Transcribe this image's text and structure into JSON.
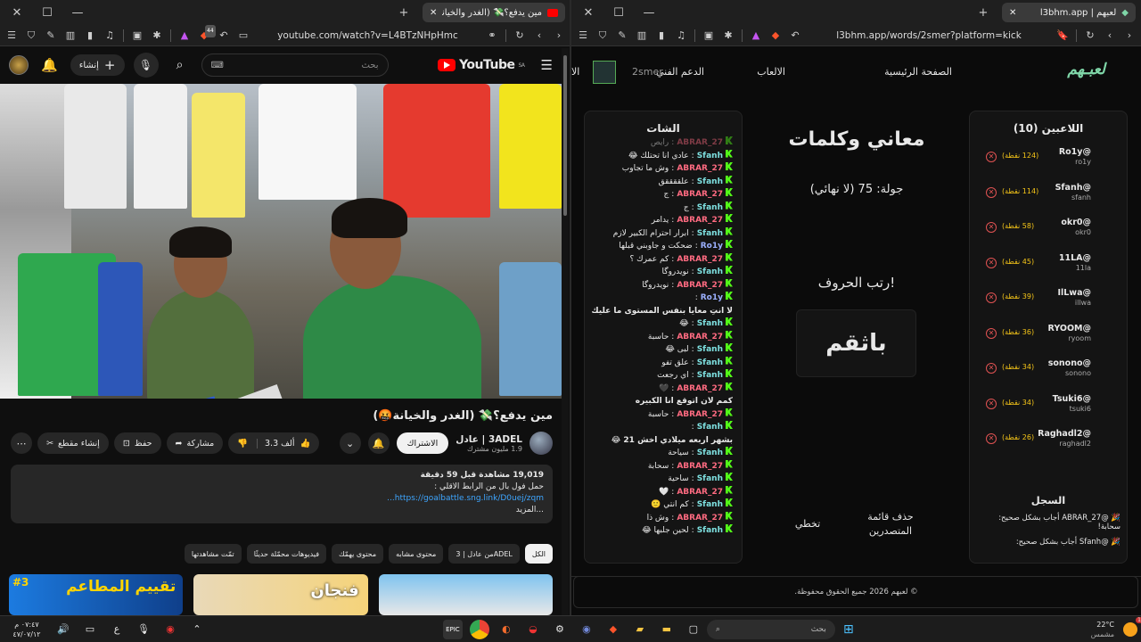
{
  "left_browser": {
    "tab_title": "مين يدفع؟💸 (الغدر والخيانة🤬)",
    "url": "youtube.com/watch?v=L4BTzNHpHmc",
    "extension_badge": "44"
  },
  "youtube": {
    "logo": "YouTube",
    "region": "SA",
    "search_placeholder": "بحث",
    "create_label": "إنشاء",
    "video_title": "مين يدفع؟💸 (الغدر والخيانة🤬)",
    "channel_name": "3ADEL | عادل",
    "channel_subs": "1.9 مليون مشترك",
    "subscribe_label": "الاشتراك",
    "likes": "3.3 ألف",
    "share_label": "مشاركة",
    "save_label": "حفظ",
    "clip_label": "إنشاء مقطع",
    "description": {
      "stats": "19,019 مشاهدة قبل 59 دقيقة",
      "line1": "حمل فول بال من الرابط الاقلي :",
      "link": "https://goalbattle.sng.link/D0uej/zqm...",
      "more": "...المزيد"
    },
    "chips": [
      "الكل",
      "من عادل | 3ADEL",
      "محتوى مشابه",
      "محتوى يهمّك",
      "فيديوهات محمّلة حديثًا",
      "تمّت مشاهدتها"
    ],
    "thumb_texts": [
      "تقييم المطاعم",
      "#3",
      "فنجان"
    ]
  },
  "right_browser": {
    "tab_title": "لعبهم | l3bhm.app",
    "url": "l3bhm.app/words/2smer?platform=kick"
  },
  "site": {
    "brand": "لعبـهم",
    "nav": [
      "الصفحة الرئيسية",
      "الالعاب",
      "الدعم الفني",
      "الا"
    ],
    "user": "2smer",
    "chat_title": "الشات",
    "chat": [
      {
        "u": "ABRAR_27",
        "m": "رايص",
        "faded": true
      },
      {
        "u": "Sfanh",
        "m": "عادي انا تحتلك 😂"
      },
      {
        "u": "ABRAR_27",
        "m": "وش ما تجاوب"
      },
      {
        "u": "Sfanh",
        "m": "علققققق"
      },
      {
        "u": "ABRAR_27",
        "m": "ج"
      },
      {
        "u": "Sfanh",
        "m": "ج"
      },
      {
        "u": "ABRAR_27",
        "m": "يدامر"
      },
      {
        "u": "Sfanh",
        "m": "ابرار احترام الكبير لازم"
      },
      {
        "u": "Ro1y",
        "m": "ضحكت و جاوبني قبلها"
      },
      {
        "u": "ABRAR_27",
        "m": "كم عمرك ؟"
      },
      {
        "u": "Sfanh",
        "m": "نويدروگا"
      },
      {
        "u": "ABRAR_27",
        "m": "نويدروگا"
      },
      {
        "u": "Ro1y",
        "m": ""
      },
      {
        "u": "",
        "m": "لا انتِ معايا بنفس المستوى ما عليك"
      },
      {
        "u": "Sfanh",
        "m": "😂"
      },
      {
        "u": "ABRAR_27",
        "m": "حاسبة"
      },
      {
        "u": "Sfanh",
        "m": "لبى 😂"
      },
      {
        "u": "Sfanh",
        "m": "علق تفو"
      },
      {
        "u": "Sfanh",
        "m": "اي رجعت"
      },
      {
        "u": "ABRAR_27",
        "m": "🖤"
      },
      {
        "u": "",
        "m": "كمم لان اتوقع انا الكبيره"
      },
      {
        "u": "ABRAR_27",
        "m": "حاسبة"
      },
      {
        "u": "Sfanh",
        "m": ""
      },
      {
        "u": "",
        "m": "بشهر اربعه ميلادي اخش 21 😂"
      },
      {
        "u": "Sfanh",
        "m": "سياحة"
      },
      {
        "u": "ABRAR_27",
        "m": "سحابة"
      },
      {
        "u": "Sfanh",
        "m": "ساحية"
      },
      {
        "u": "ABRAR_27",
        "m": "🤍"
      },
      {
        "u": "Sfanh",
        "m": "كم انتي 🙂"
      },
      {
        "u": "ABRAR_27",
        "m": "وش ذا"
      },
      {
        "u": "Sfanh",
        "m": "لحين جلبها 😂"
      }
    ],
    "game_title": "معاني وكلمات",
    "round": "جولة: 75 (لا نهائي)",
    "instruction": "رتب الحروف!",
    "scrambled": "باثقم",
    "skip_label": "تخطي",
    "clear_label": "حذف قائمة المتصدرين",
    "players_title": "اللاعبين (10)",
    "players": [
      {
        "name": "@Ro1y",
        "handle": "ro1y",
        "points": "(124 نقطة)"
      },
      {
        "name": "@Sfanh",
        "handle": "sfanh",
        "points": "(114 نقطة)"
      },
      {
        "name": "@okr0",
        "handle": "okr0",
        "points": "(58 نقطة)"
      },
      {
        "name": "@11LA",
        "handle": "11la",
        "points": "(45 نقطة)"
      },
      {
        "name": "@IlLwa",
        "handle": "illwa",
        "points": "(39 نقطة)"
      },
      {
        "name": "@RYOOM",
        "handle": "ryoom",
        "points": "(36 نقطة)"
      },
      {
        "name": "@sonono",
        "handle": "sonono",
        "points": "(34 نقطة)"
      },
      {
        "name": "@Tsuki6",
        "handle": "tsuki6",
        "points": "(34 نقطة)"
      },
      {
        "name": "@Raghadl2",
        "handle": "raghadl2",
        "points": "(26 نقطة)"
      }
    ],
    "log_title": "السجل",
    "log": [
      "🎉 @ABRAR_27 أجاب بشكل صحيح: سحابة!",
      "🎉 @Sfanh أجاب بشكل صحيح:"
    ],
    "footer": "© لعبهم 2026 جميع الحقوق محفوظة."
  },
  "taskbar": {
    "search": "بحث",
    "time": "٠٧:٤٧ م",
    "date": "٤٧/٠٧/١٢",
    "lang": "ع",
    "weather_temp": "22°C",
    "weather_desc": "مشمس",
    "notif_count": "1"
  }
}
